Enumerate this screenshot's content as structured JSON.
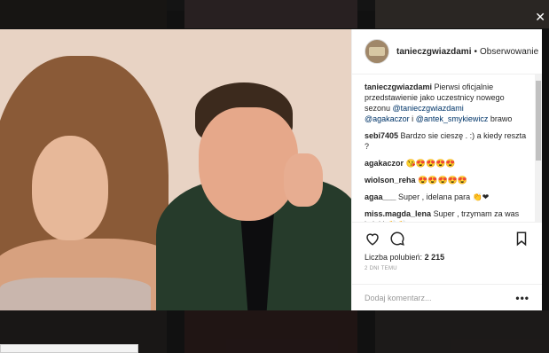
{
  "header": {
    "username": "tanieczgwiazdami",
    "separator": "•",
    "follow_label": "Obserwowanie"
  },
  "comments": [
    {
      "user": "tanieczgwiazdami",
      "text_before": "Pierwsi oficjalnie przedstawienie jako uczestnicy nowego sezonu ",
      "mention1": "@tanieczgwiazdami",
      "mid": "",
      "mention2": "@agakaczor",
      "and": " i ",
      "mention3": "@antek_smykiewicz",
      "text_after": " brawo"
    },
    {
      "user": "sebi7405",
      "text": "Bardzo sie cieszę . :) a kiedy reszta ?"
    },
    {
      "user": "agakaczor",
      "text": "😘😍😍😍😍"
    },
    {
      "user": "wiolson_reha",
      "text": "😍😍😍😍😍"
    },
    {
      "user": "agaa___",
      "text": "Super , idelana para 👏❤"
    },
    {
      "user": "miss.magda_lena",
      "text": "Super , trzymam za was kciuki 👏👏"
    }
  ],
  "actions": {
    "likes_label": "Liczba polubień:",
    "likes_count": "2 215",
    "time": "2 DNI TEMU"
  },
  "add_comment": {
    "placeholder": "Dodaj komentarz...",
    "more_icon": "•••"
  },
  "close_icon": "✕",
  "icons": [
    "heart-icon",
    "comment-icon",
    "bookmark-icon",
    "more-icon",
    "close-icon"
  ]
}
